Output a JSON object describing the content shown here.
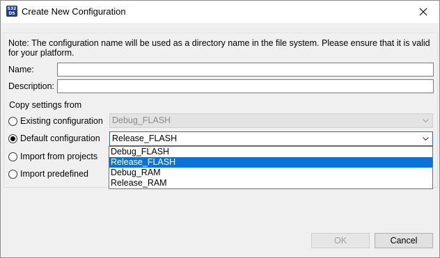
{
  "window": {
    "title": "Create New Configuration",
    "icon_text_line1": "S32",
    "icon_text_line2": "DS"
  },
  "note": "Note: The configuration name will be used as a directory name in the file system.  Please ensure that it is valid for your platform.",
  "fields": {
    "name_label": "Name:",
    "name_value": "",
    "description_label": "Description:",
    "description_value": ""
  },
  "copy_settings": {
    "title": "Copy settings from",
    "options": [
      {
        "label": "Existing configuration",
        "checked": false
      },
      {
        "label": "Default configuration",
        "checked": true
      },
      {
        "label": "Import from projects",
        "checked": false
      },
      {
        "label": "Import predefined",
        "checked": false
      }
    ],
    "existing_combo_value": "Debug_FLASH",
    "default_combo_value": "Release_FLASH",
    "dropdown_items": [
      "Debug_FLASH",
      "Release_FLASH",
      "Debug_RAM",
      "Release_RAM"
    ],
    "dropdown_selected": "Release_FLASH"
  },
  "buttons": {
    "ok": "OK",
    "cancel": "Cancel"
  },
  "icons": {
    "close": "close-icon",
    "chevron": "chevron-down-icon",
    "app": "app-icon"
  },
  "colors": {
    "selection": "#0a74d6",
    "app_icon": "#1f3f86"
  }
}
